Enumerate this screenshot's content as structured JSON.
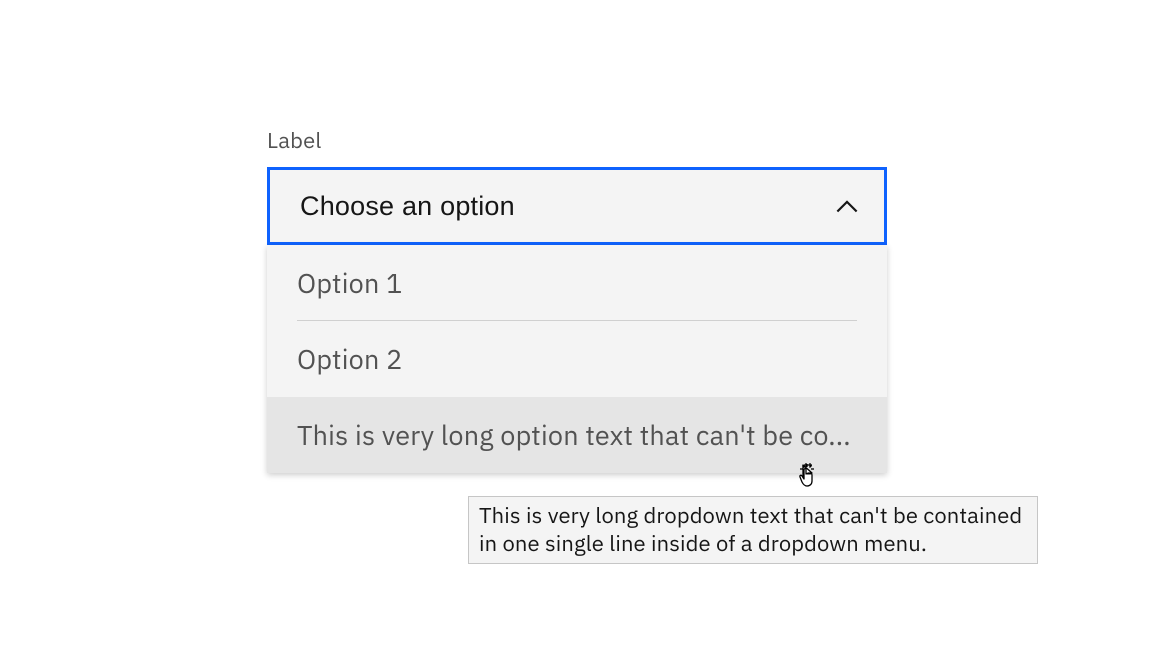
{
  "dropdown": {
    "label": "Label",
    "placeholder": "Choose an option",
    "options": [
      {
        "text": "Option 1"
      },
      {
        "text": "Option 2"
      },
      {
        "text": "This is very long option text that can't be co..."
      }
    ]
  },
  "tooltip": {
    "text": "This is very long dropdown text that can't be contained in one single line inside of a dropdown menu."
  },
  "colors": {
    "focus": "#0f62fe",
    "field_bg": "#f4f4f4",
    "hover_bg": "#e5e5e5",
    "text_primary": "#161616",
    "text_secondary": "#525252"
  }
}
